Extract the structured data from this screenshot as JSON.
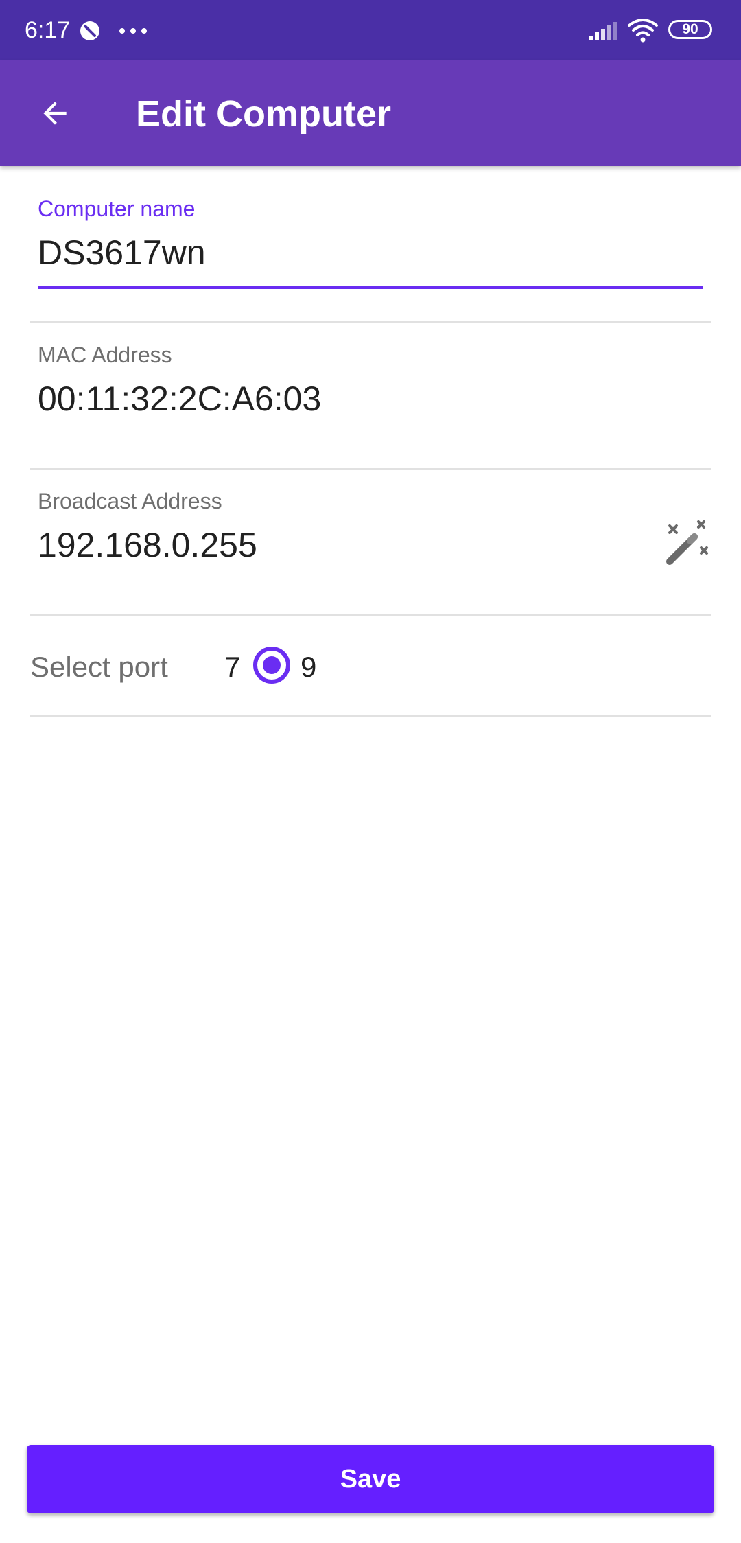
{
  "status_bar": {
    "time": "6:17",
    "battery": "90",
    "icons": [
      "dnd-icon",
      "more-dots-icon",
      "signal-icon",
      "wifi-icon",
      "battery-icon"
    ]
  },
  "app_bar": {
    "title": "Edit Computer",
    "back_icon": "arrow-back-icon",
    "color": "#673ab7"
  },
  "form": {
    "computer_name": {
      "label": "Computer name",
      "value": "DS3617wn"
    },
    "mac_address": {
      "label": "MAC Address",
      "value": "00:11:32:2C:A6:03"
    },
    "broadcast_address": {
      "label": "Broadcast Address",
      "value": "192.168.0.255",
      "action_icon": "magic-wand-icon"
    },
    "port": {
      "label": "Select port",
      "options": [
        "7",
        "9"
      ],
      "selected": "9"
    }
  },
  "save_button": {
    "label": "Save",
    "color": "#651fff"
  },
  "colors": {
    "status_bar": "#4a2fa6",
    "accent": "#6a2df2"
  }
}
